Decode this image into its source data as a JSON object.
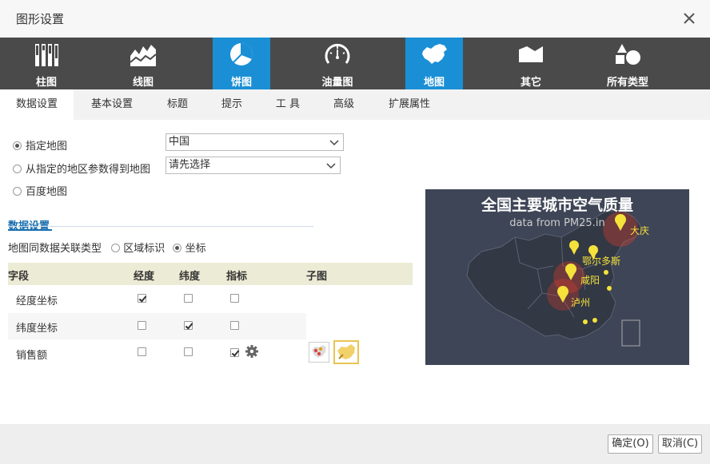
{
  "dialog": {
    "title": "图形设置"
  },
  "chart_types": [
    {
      "label": "柱图",
      "icon": "bar-chart-icon",
      "active": false
    },
    {
      "label": "线图",
      "icon": "line-chart-icon",
      "active": false
    },
    {
      "label": "饼图",
      "icon": "pie-chart-icon",
      "active": true
    },
    {
      "label": "油量图",
      "icon": "gauge-chart-icon",
      "active": false
    },
    {
      "label": "地图",
      "icon": "map-chart-icon",
      "active": true
    },
    {
      "label": "其它",
      "icon": "other-chart-icon",
      "active": false
    },
    {
      "label": "所有类型",
      "icon": "all-types-icon",
      "active": false
    }
  ],
  "tabs": [
    "数据设置",
    "基本设置",
    "标题",
    "提示",
    "工 具",
    "高级",
    "扩展属性"
  ],
  "map_source": {
    "opt1": "指定地图",
    "opt2": "从指定的地区参数得到地图",
    "opt3": "百度地图",
    "select1": "中国",
    "select2": "请先选择"
  },
  "data_section": {
    "title": "数据设置",
    "assoc_label": "地图同数据关联类型",
    "assoc_opt1": "区域标识",
    "assoc_opt2": "坐标"
  },
  "table": {
    "headers": [
      "字段",
      "经度",
      "纬度",
      "指标",
      "子图"
    ],
    "rows": [
      {
        "label": "经度坐标",
        "lng": true,
        "lat": false,
        "metric": false
      },
      {
        "label": "纬度坐标",
        "lng": false,
        "lat": true,
        "metric": false
      },
      {
        "label": "销售额",
        "lng": false,
        "lat": false,
        "metric": true
      }
    ]
  },
  "preview": {
    "title": "全国主要城市空气质量",
    "subtitle": "data from PM25.in",
    "cities": [
      "大庆",
      "鄂尔多斯",
      "咸阳",
      "泸州"
    ]
  },
  "footer": {
    "ok": "确定(O)",
    "cancel": "取消(C)"
  },
  "colors": {
    "accent": "#1a8fd6",
    "toolbar": "#4a4a4a",
    "map_bg": "#3e4556",
    "marker": "#f5e23b"
  }
}
